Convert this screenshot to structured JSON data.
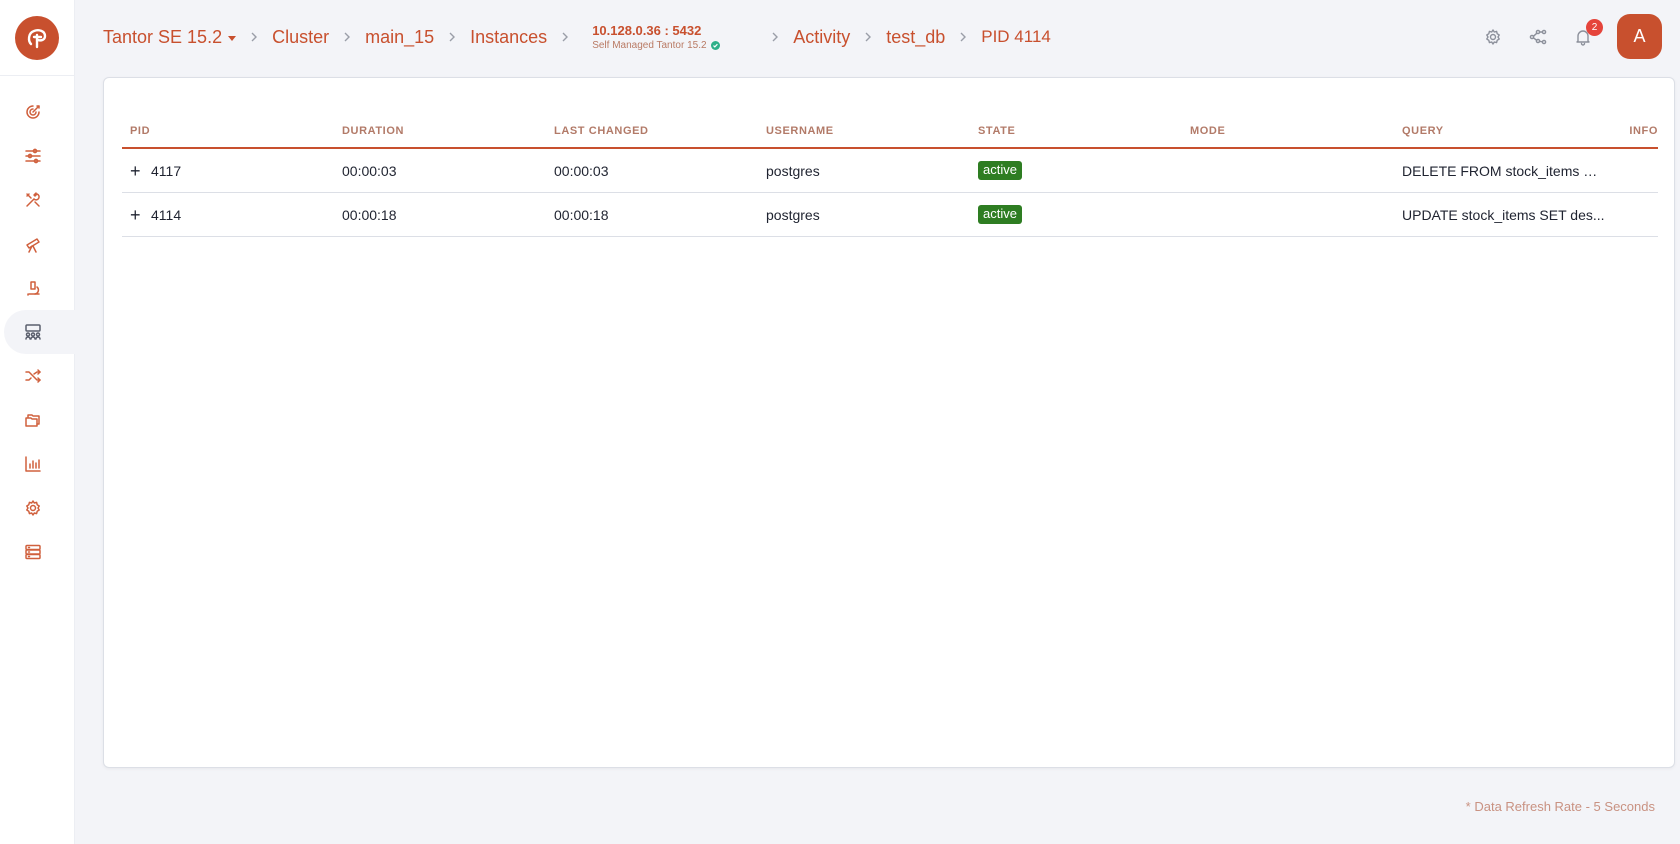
{
  "app": {
    "logo_icon": "tantor-logo-icon",
    "brand_color": "#c8502e"
  },
  "sidebar": {
    "items": [
      {
        "icon": "target-icon",
        "active": false
      },
      {
        "icon": "sliders-icon",
        "active": false
      },
      {
        "icon": "tools-icon",
        "active": false
      },
      {
        "icon": "telescope-icon",
        "active": false
      },
      {
        "icon": "microscope-icon",
        "active": false
      },
      {
        "icon": "users-activity-icon",
        "active": true
      },
      {
        "icon": "shuffle-icon",
        "active": false
      },
      {
        "icon": "folders-icon",
        "active": false
      },
      {
        "icon": "bar-chart-icon",
        "active": false
      },
      {
        "icon": "gear-icon",
        "active": false
      },
      {
        "icon": "storage-icon",
        "active": false
      }
    ]
  },
  "breadcrumb": {
    "product": "Tantor SE 15.2",
    "cluster": "Cluster",
    "main": "main_15",
    "instances": "Instances",
    "host_addr": "10.128.0.36 : 5432",
    "host_sub": "Self Managed Tantor 15.2",
    "activity": "Activity",
    "db": "test_db",
    "pid": "PID 4114"
  },
  "header": {
    "notifications_count": "2",
    "avatar_letter": "A"
  },
  "table": {
    "columns": [
      "PID",
      "DURATION",
      "LAST CHANGED",
      "USERNAME",
      "STATE",
      "MODE",
      "QUERY",
      "INFO"
    ],
    "rows": [
      {
        "pid": "4117",
        "duration": "00:00:03",
        "last_changed": "00:00:03",
        "username": "postgres",
        "state": "active",
        "mode": "",
        "query": "DELETE FROM stock_items WH...",
        "info": ""
      },
      {
        "pid": "4114",
        "duration": "00:00:18",
        "last_changed": "00:00:18",
        "username": "postgres",
        "state": "active",
        "mode": "",
        "query": "UPDATE stock_items SET des...",
        "info": ""
      }
    ]
  },
  "footer": {
    "refresh_note": "* Data Refresh Rate - 5 Seconds"
  }
}
